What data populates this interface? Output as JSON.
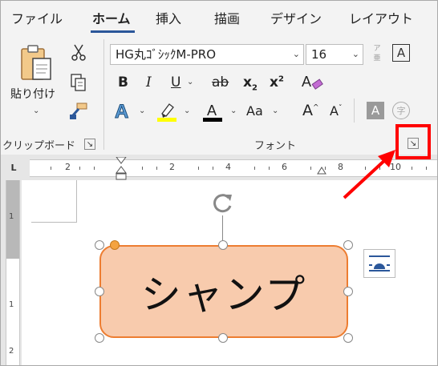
{
  "tabs": [
    {
      "label": "ファイル",
      "active": false
    },
    {
      "label": "ホーム",
      "active": true
    },
    {
      "label": "挿入",
      "active": false
    },
    {
      "label": "描画",
      "active": false
    },
    {
      "label": "デザイン",
      "active": false
    },
    {
      "label": "レイアウト",
      "active": false
    }
  ],
  "clipboard": {
    "paste_label": "貼り付け",
    "group_label": "クリップボード"
  },
  "font": {
    "name": "HG丸ｺﾞｼｯｸM-PRO",
    "size": "16",
    "group_label": "フォント",
    "bold": "B",
    "italic": "I",
    "underline": "U",
    "strikethrough": "ab",
    "subscript": "x",
    "subscript_sub": "2",
    "superscript": "x",
    "superscript_sup": "2",
    "case_label": "Aa",
    "phonetic_top": "ア",
    "phonetic_bottom": "亜",
    "enclose_label": "A",
    "enclose_circle": "字",
    "highlight_color": "#ffff00",
    "font_color": "#000000"
  },
  "ruler": {
    "numbers": [
      "2",
      "2",
      "4",
      "6",
      "8",
      "10"
    ]
  },
  "vertical_ruler": {
    "numbers": [
      "1",
      "1",
      "2"
    ]
  },
  "shape": {
    "text": "シャンプ",
    "fill_color": "#f8cbad",
    "border_color": "#ed7d31"
  },
  "annotation": {
    "color": "#ff0000"
  }
}
